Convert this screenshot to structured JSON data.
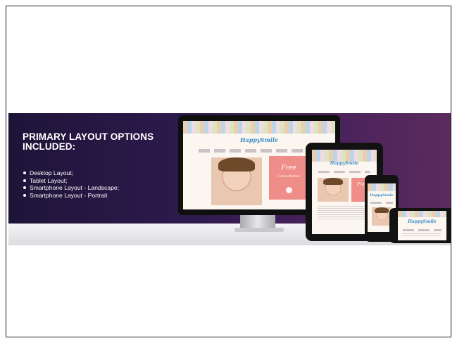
{
  "banner": {
    "heading": "PRIMARY LAYOUT OPTIONS INCLUDED:",
    "options": [
      "Desktop Layout;",
      "Tablet Layout;",
      "Smartphone Layout - Landscape;",
      "Smartphone Layout - Portrait"
    ]
  },
  "site": {
    "logo": "HappySmile",
    "promo_title": "Free",
    "promo_subtitle": "Consultation"
  },
  "colors": {
    "banner_gradient_start": "#1e1438",
    "banner_gradient_end": "#5c2b5e",
    "promo": "#ef8e88",
    "logo": "#3e8ec4"
  },
  "icons": [
    "monitor-device",
    "tablet-device",
    "smartphone-portrait-device",
    "smartphone-landscape-device"
  ]
}
